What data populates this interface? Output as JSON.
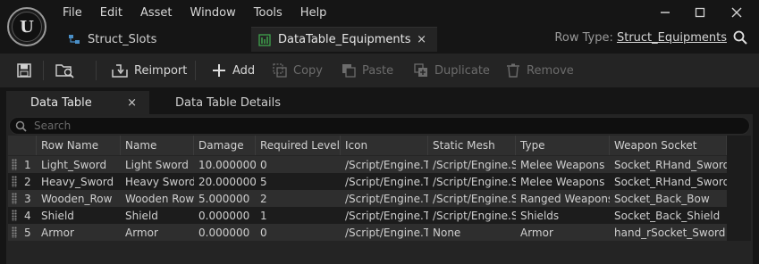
{
  "menu": [
    "File",
    "Edit",
    "Asset",
    "Window",
    "Tools",
    "Help"
  ],
  "logo_letter": "U",
  "tabs": {
    "inactive_label": "Struct_Slots",
    "active_label": "DataTable_Equipments",
    "close_glyph": "×"
  },
  "row_type": {
    "label": "Row Type:",
    "value": "Struct_Equipments"
  },
  "toolbar": {
    "reimport": "Reimport",
    "add": "Add",
    "copy": "Copy",
    "paste": "Paste",
    "duplicate": "Duplicate",
    "remove": "Remove"
  },
  "subtabs": {
    "active": "Data Table",
    "inactive": "Data Table Details",
    "close_glyph": "×"
  },
  "search": {
    "placeholder": "Search"
  },
  "table": {
    "columns": [
      "Row Name",
      "Name",
      "Damage",
      "Required Level",
      "Icon",
      "Static Mesh",
      "Type",
      "Weapon Socket"
    ],
    "rows": [
      {
        "index": "1",
        "row_name": "Light_Sword",
        "name": "Light Sword",
        "damage": "10.000000",
        "level": "0",
        "icon": "/Script/Engine.Te",
        "mesh": "/Script/Engine.St",
        "type": "Melee Weapons",
        "socket": "Socket_RHand_Sword"
      },
      {
        "index": "2",
        "row_name": "Heavy_Sword",
        "name": "Heavy Sword",
        "damage": "20.000000",
        "level": "5",
        "icon": "/Script/Engine.Te",
        "mesh": "/Script/Engine.St",
        "type": "Melee Weapons",
        "socket": "Socket_RHand_Sword"
      },
      {
        "index": "3",
        "row_name": "Wooden_Row",
        "name": "Wooden Row",
        "damage": "5.000000",
        "level": "2",
        "icon": "/Script/Engine.Te",
        "mesh": "/Script/Engine.St",
        "type": "Ranged Weapons",
        "socket": "Socket_Back_Bow"
      },
      {
        "index": "4",
        "row_name": "Shield",
        "name": "Shield",
        "damage": "0.000000",
        "level": "1",
        "icon": "/Script/Engine.Te",
        "mesh": "/Script/Engine.St",
        "type": "Shields",
        "socket": "Socket_Back_Shield"
      },
      {
        "index": "5",
        "row_name": "Armor",
        "name": "Armor",
        "damage": "0.000000",
        "level": "0",
        "icon": "/Script/Engine.Te",
        "mesh": "None",
        "type": "Armor",
        "socket": "hand_rSocket_Sword"
      }
    ]
  },
  "icons": {
    "logo": "unreal-logo-icon",
    "struct_tab": "struct-icon",
    "datatable_tab": "datatable-icon",
    "search": "search-icon",
    "save": "save-icon",
    "browse": "browse-icon",
    "reimport": "reimport-icon",
    "add": "plus-icon",
    "copy": "copy-icon",
    "paste": "paste-icon",
    "duplicate": "duplicate-icon",
    "remove": "trash-icon"
  },
  "colors": {
    "background": "#151515",
    "panel": "#242424",
    "row_even": "#2e2e2e",
    "row_odd": "#1c1c1c",
    "datatable_icon": "#3fa34d",
    "struct_icon": "#4a8fc7"
  }
}
